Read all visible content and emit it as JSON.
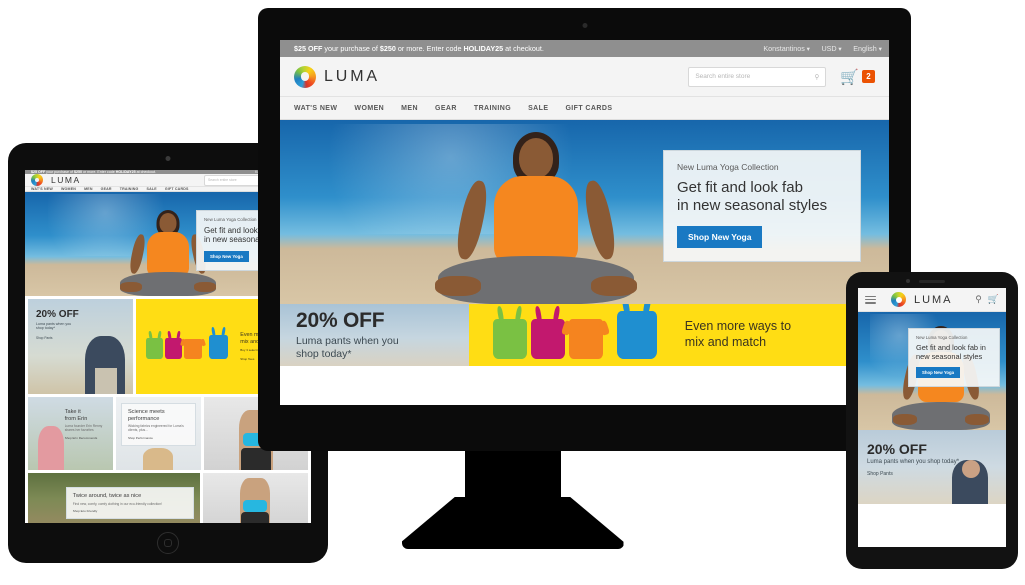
{
  "store": {
    "brand": "LUMA",
    "promo": {
      "amount": "$25 OFF",
      "text_1": " your purchase of ",
      "threshold": "$250",
      "text_2": " or more.  Enter code ",
      "code": "HOLIDAY25",
      "text_3": " at checkout."
    },
    "account": {
      "user": "Konstantinos",
      "currency": "USD",
      "language": "English"
    },
    "search_placeholder": "Search entire store",
    "cart_count": "2",
    "nav": [
      "WAT'S NEW",
      "WOMEN",
      "MEN",
      "GEAR",
      "TRAINING",
      "SALE",
      "GIFT CARDS"
    ],
    "hero": {
      "eyebrow": "New Luma Yoga Collection",
      "headline_line1": "Get fit and look fab",
      "headline_line2": "in new seasonal styles",
      "headline_mobile": "Get fit and look fab in new seasonal styles",
      "cta": "Shop New Yoga"
    },
    "promo_pants": {
      "headline": "20% OFF",
      "sub_line1": "Luma pants when you",
      "sub_line2": "shop today*",
      "sub_mobile": "Luma pants when you shop today*",
      "link": "Shop Pants"
    },
    "promo_mix": {
      "line1": "Even more ways to",
      "line2": "mix and match",
      "sub": "Buy 3 select things & get 1 free",
      "link": "Shop Tees"
    },
    "tiles": [
      {
        "headline_line1": "Take it",
        "headline_line2": "from Erin",
        "body": "Luma founder Erin Renny shares her favorites",
        "link": "Shop Erin Recommends"
      },
      {
        "headline_line1": "Science meets",
        "headline_line2": "performance",
        "body": "Wicking fabrics engineered for Luma's clients, plus...",
        "link": "Shop Performance"
      },
      {
        "headline_line1": "Twice around, twice as nice",
        "headline_line2": "",
        "body": "Find new, comfy, comfy clothing in our eco-friendly collection!",
        "link": "Shop Eco Friendly"
      }
    ],
    "colors": {
      "promo_bar": "#8f8f8f",
      "cta_blue": "#1979c3",
      "cart_badge": "#eb5202",
      "mix_yellow": "#ffdd14",
      "tank_green": "#7ac143",
      "tank_magenta": "#c2186e",
      "tank_orange": "#f5841f",
      "tank_blue": "#1f8fd0",
      "shirt_orange": "#f5871f"
    }
  },
  "icons": {
    "search": "search-icon",
    "cart": "cart-icon",
    "menu": "hamburger-menu-icon",
    "chevron": "chevron-down-icon"
  }
}
